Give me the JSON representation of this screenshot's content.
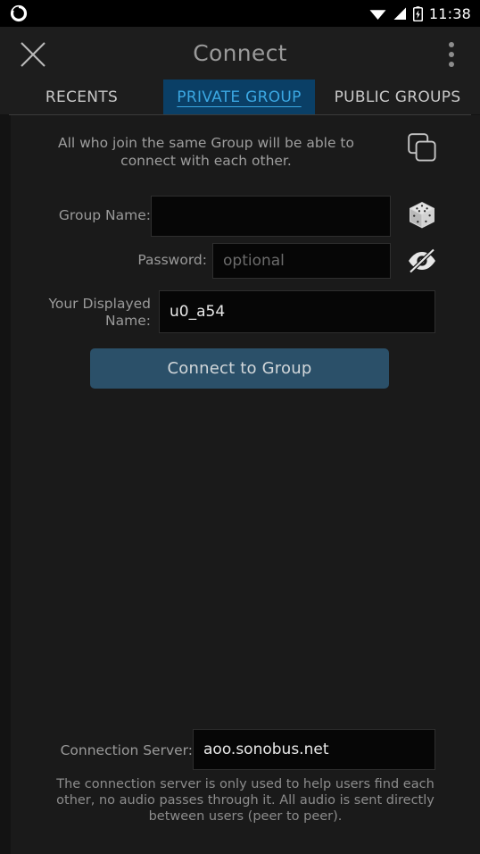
{
  "statusbar": {
    "notification_icon": "circle-notification-icon",
    "wifi_icon": "wifi-icon",
    "signal_icon": "cell-signal-icon",
    "battery_icon": "battery-charging-icon",
    "time": "11:38"
  },
  "titlebar": {
    "close_icon": "close-icon",
    "title": "Connect",
    "overflow_icon": "more-vertical-icon"
  },
  "tabs": [
    {
      "label": "RECENTS",
      "active": false
    },
    {
      "label": "PRIVATE GROUP",
      "active": true
    },
    {
      "label": "PUBLIC GROUPS",
      "active": false
    }
  ],
  "main": {
    "info_text": "All who join the same Group will be able to connect with each other.",
    "copy_icon": "copy-icon",
    "group_name": {
      "label": "Group Name:",
      "value": "",
      "placeholder": "",
      "random_icon": "dice-icon"
    },
    "password": {
      "label": "Password:",
      "value": "",
      "placeholder": "optional",
      "reveal_icon": "eye-off-icon"
    },
    "displayed_name": {
      "label": "Your Displayed Name:",
      "value": "u0_a54",
      "placeholder": ""
    },
    "connect_button": "Connect to Group"
  },
  "footer": {
    "server_label": "Connection Server:",
    "server_value": "aoo.sonobus.net",
    "server_note": "The connection server is only used to help users find each other, no audio passes through it. All audio is sent directly between users (peer to peer)."
  },
  "colors": {
    "background": "#131313",
    "panel": "#1a1a1a",
    "titlebar": "#1d1d1d",
    "active_tab_bg": "#0a3f66",
    "active_tab_text": "#3ba7e2",
    "button": "#2b5069",
    "field_bg": "#060606",
    "text_muted": "#9a9a9a"
  }
}
